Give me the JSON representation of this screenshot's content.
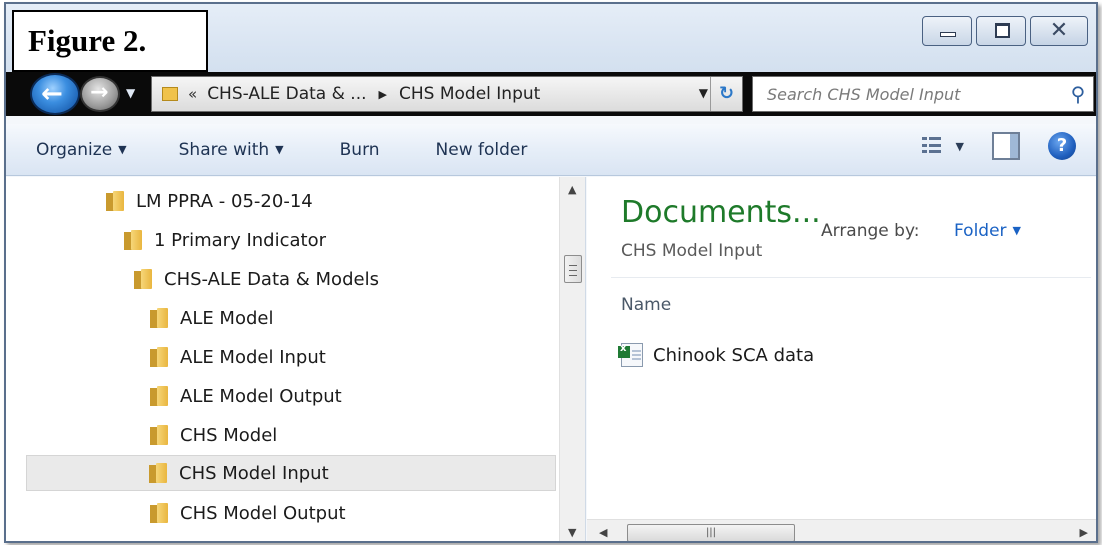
{
  "figure_label": "Figure 2.",
  "address": {
    "separator": "«",
    "crumbs": [
      "CHS-ALE Data & ...",
      "CHS Model Input"
    ]
  },
  "search": {
    "placeholder": "Search CHS Model Input"
  },
  "toolbar": {
    "organize": "Organize",
    "share_with": "Share with",
    "burn": "Burn",
    "new_folder": "New folder"
  },
  "tree": [
    {
      "label": "LM PPRA - 05-20-14",
      "selected": false
    },
    {
      "label": "1 Primary Indicator",
      "selected": false
    },
    {
      "label": "CHS-ALE Data & Models",
      "selected": false
    },
    {
      "label": "ALE Model",
      "selected": false
    },
    {
      "label": "ALE Model Input",
      "selected": false
    },
    {
      "label": "ALE Model Output",
      "selected": false
    },
    {
      "label": "CHS Model",
      "selected": false
    },
    {
      "label": "CHS Model Input",
      "selected": true
    },
    {
      "label": "CHS Model Output",
      "selected": false
    }
  ],
  "library": {
    "title": "Documents...",
    "subtitle": "CHS Model Input",
    "arrange_label": "Arrange by:",
    "arrange_value": "Folder"
  },
  "columns": {
    "name": "Name"
  },
  "files": [
    {
      "name": "Chinook SCA data",
      "icon": "excel-file-icon"
    }
  ],
  "colors": {
    "library_title": "#1e7a2a",
    "arrange_link": "#1a62c4",
    "selection": "#eaeaea",
    "folder": "#e9b63f"
  }
}
